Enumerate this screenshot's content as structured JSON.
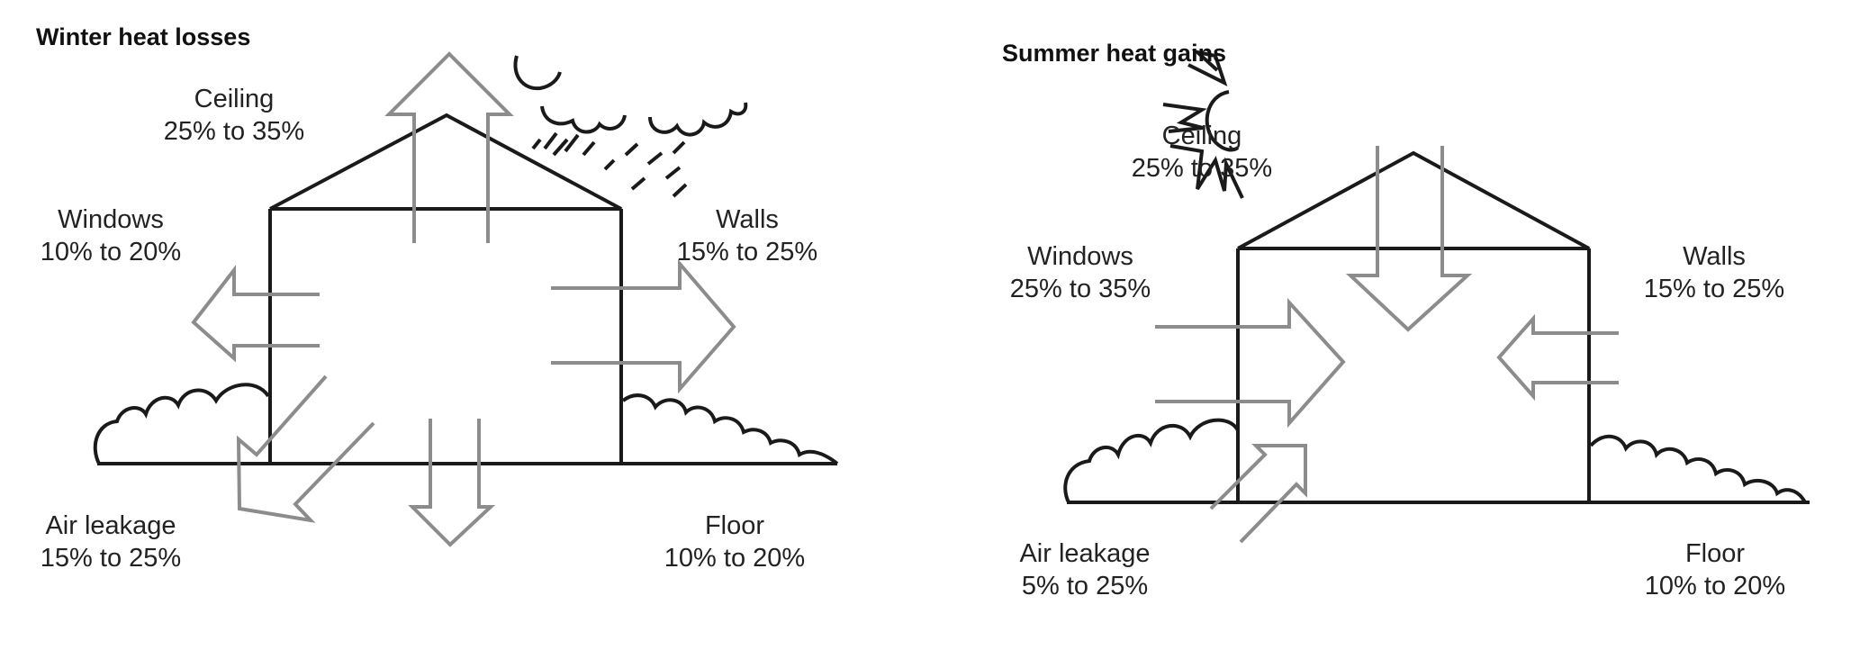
{
  "winter": {
    "title": "Winter heat losses",
    "ceiling": {
      "name": "Ceiling",
      "range": "25% to 35%"
    },
    "windows": {
      "name": "Windows",
      "range": "10% to 20%"
    },
    "walls": {
      "name": "Walls",
      "range": "15% to 25%"
    },
    "air_leakage": {
      "name": "Air leakage",
      "range": "15% to 25%"
    },
    "floor": {
      "name": "Floor",
      "range": "10% to 20%"
    }
  },
  "summer": {
    "title": "Summer heat gains",
    "ceiling": {
      "name": "Ceiling",
      "range": "25% to 35%"
    },
    "windows": {
      "name": "Windows",
      "range": "25% to 35%"
    },
    "walls": {
      "name": "Walls",
      "range": "15% to 25%"
    },
    "air_leakage": {
      "name": "Air leakage",
      "range": "5% to 25%"
    },
    "floor": {
      "name": "Floor",
      "range": "10% to 20%"
    }
  },
  "colors": {
    "line": "#1a1a1a",
    "arrow": "#8c8c8c",
    "background": "#ffffff"
  },
  "icons": {
    "weather": "rain-cloud-icon",
    "sun": "sun-icon"
  }
}
